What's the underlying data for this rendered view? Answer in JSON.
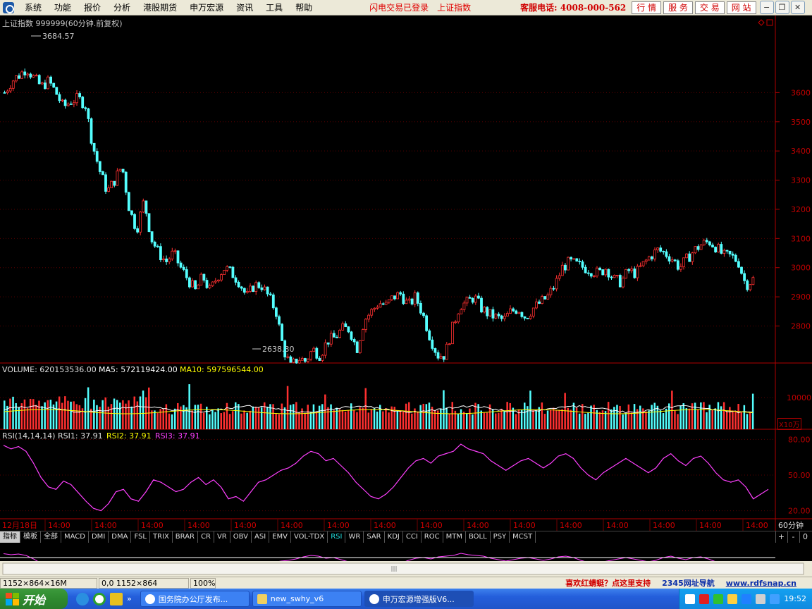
{
  "menu": {
    "items": [
      "系统",
      "功能",
      "报价",
      "分析",
      "港股期货",
      "申万宏源",
      "资讯",
      "工具",
      "帮助"
    ],
    "login_status": "闪电交易已登录",
    "index_name": "上证指数",
    "hotline": "客服电话: 4008-000-562",
    "nav_buttons": [
      "行 情",
      "服 务",
      "交 易",
      "网 站"
    ]
  },
  "chart_title": "上证指数 999999(60分钟.前复权)",
  "price_labels": {
    "high": "3684.57",
    "low": "2638.30"
  },
  "volume_legend": {
    "volume": "VOLUME: 620153536.00",
    "ma5": "MA5: 572119424.00",
    "ma10": "MA10: 597596544.00"
  },
  "volume_unit": "X10万",
  "rsi_legend": {
    "title": "RSI(14,14,14)",
    "rsi1": "RSI1: 37.91",
    "rsi2": "RSI2: 37.91",
    "rsi3": "RSI3: 37.91"
  },
  "time_axis": {
    "labels": [
      "12月18日",
      "14:00",
      "14:00",
      "14:00",
      "14:00",
      "14:00",
      "14:00",
      "14:00",
      "14:00",
      "14:00",
      "14:00",
      "14:00",
      "14:00",
      "14:00",
      "14:00",
      "14:00",
      "14:00"
    ],
    "period": "60分钟"
  },
  "tabs": [
    "指标",
    "模板",
    "全部",
    "MACD",
    "DMI",
    "DMA",
    "FSL",
    "TRIX",
    "BRAR",
    "CR",
    "VR",
    "OBV",
    "ASI",
    "EMV",
    "VOL-TDX",
    "RSI",
    "WR",
    "SAR",
    "KDJ",
    "CCI",
    "ROC",
    "MTM",
    "BOLL",
    "PSY",
    "MCST"
  ],
  "active_tab": "RSI",
  "tab_controls": [
    "+",
    "-",
    "0"
  ],
  "statusbar": {
    "cells": [
      "1152×864×16M",
      "0,0 1152×864",
      "100%"
    ],
    "promo": "喜欢红蜻蜓？点这里支持",
    "nav": "2345网址导航",
    "url": "www.rdfsnap.cn"
  },
  "taskbar": {
    "start": "开始",
    "tasks": [
      "国务院办公厅发布...",
      "new_swhy_v6",
      "申万宏源增强版V6..."
    ],
    "clock": "19:52"
  },
  "colors": {
    "up": "#ff3030",
    "down": "#54ffff",
    "ma5": "#ffffff",
    "ma10": "#ffff00",
    "rsi": "#ff40ff",
    "axis": "#b00000"
  },
  "chart_data": [
    {
      "type": "candlestick",
      "title": "上证指数 999999(60分钟.前复权)",
      "ylim": [
        2600,
        3700
      ],
      "yticks": [
        2800,
        2900,
        3000,
        3100,
        3200,
        3300,
        3400,
        3500,
        3600
      ],
      "close_trend": [
        3600,
        3640,
        3660,
        3684,
        3650,
        3620,
        3640,
        3600,
        3550,
        3570,
        3580,
        3560,
        3420,
        3330,
        3260,
        3300,
        3350,
        3200,
        3130,
        3230,
        3100,
        3050,
        3020,
        3050,
        3000,
        2960,
        2920,
        2970,
        2920,
        2970,
        3000,
        2980,
        2950,
        2900,
        2940,
        2940,
        2900,
        2850,
        2720,
        2660,
        2690,
        2680,
        2720,
        2700,
        2750,
        2760,
        2790,
        2790,
        2720,
        2820,
        2850,
        2880,
        2870,
        2900,
        2910,
        2870,
        2900,
        2840,
        2760,
        2700,
        2700,
        2790,
        2870,
        2880,
        2900,
        2860,
        2840,
        2830,
        2820,
        2850,
        2860,
        2830,
        2860,
        2880,
        2900,
        2940,
        3000,
        3020,
        3010,
        3000,
        2990,
        2980,
        3000,
        2960,
        2950,
        2990,
        2980,
        3010,
        3040,
        3060,
        3050,
        3030,
        3000,
        3030,
        3060,
        3080,
        3090,
        3070,
        3040,
        3040,
        3020,
        2940,
        2960
      ],
      "high_label": "3684.57",
      "low_label": "2638.30"
    },
    {
      "type": "bar",
      "title": "VOLUME",
      "ytick": "10000",
      "unit": "X10万"
    },
    {
      "type": "line",
      "title": "RSI(14,14,14)",
      "ylim": [
        15,
        85
      ],
      "yticks": [
        20.0,
        50.0,
        80.0
      ],
      "values": [
        75,
        72,
        74,
        70,
        60,
        48,
        40,
        38,
        45,
        42,
        35,
        28,
        22,
        20,
        26,
        36,
        38,
        30,
        28,
        36,
        46,
        44,
        40,
        36,
        38,
        44,
        48,
        42,
        46,
        40,
        30,
        32,
        28,
        36,
        44,
        46,
        50,
        54,
        56,
        60,
        66,
        70,
        68,
        62,
        64,
        58,
        52,
        44,
        38,
        32,
        30,
        34,
        40,
        48,
        56,
        62,
        64,
        60,
        66,
        68,
        70,
        76,
        72,
        70,
        68,
        62,
        58,
        54,
        58,
        62,
        64,
        60,
        56,
        60,
        66,
        68,
        64,
        56,
        50,
        46,
        52,
        56,
        60,
        64,
        60,
        56,
        52,
        56,
        64,
        68,
        62,
        58,
        64,
        66,
        60,
        52,
        46,
        44,
        46,
        40,
        30,
        34,
        38
      ]
    }
  ]
}
